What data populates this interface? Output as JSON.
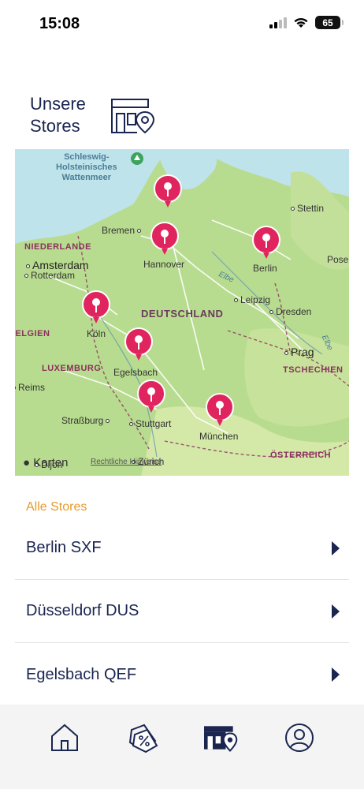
{
  "status_bar": {
    "time": "15:08",
    "battery": "65"
  },
  "header": {
    "title": "Unsere Stores",
    "icon": "store-location-icon"
  },
  "map": {
    "water_label": [
      "Schleswig-",
      "Holsteinisches",
      "Wattenmeer"
    ],
    "country_labels": [
      "NIEDERLANDE",
      "BELGIEN",
      "LUXEMBURG",
      "TSCHECHIEN",
      "ÖSTERREICH",
      "DEUTSCHLAND"
    ],
    "cities": [
      "Stettin",
      "Bremen",
      "Hannover",
      "Berlin",
      "Amsterdam",
      "Rotterdam",
      "Leipzig",
      "Dresden",
      "Köln",
      "Prag",
      "Egelsbach",
      "Reims",
      "Straßburg",
      "Stuttgart",
      "München",
      "Dijon",
      "Zürich",
      "Pose",
      "Elbe",
      "Elbe"
    ],
    "credit": "Karten",
    "legal": "Rechtliche Hinweise"
  },
  "stores": {
    "section_label": "Alle Stores",
    "items": [
      "Berlin SXF",
      "Düsseldorf DUS",
      "Egelsbach QEF"
    ]
  },
  "tabs": [
    "home-icon",
    "coupons-icon",
    "stores-icon",
    "profile-icon"
  ],
  "colors": {
    "navy": "#1a2550",
    "accent": "#e69a2b",
    "pin": "#e0245e"
  }
}
